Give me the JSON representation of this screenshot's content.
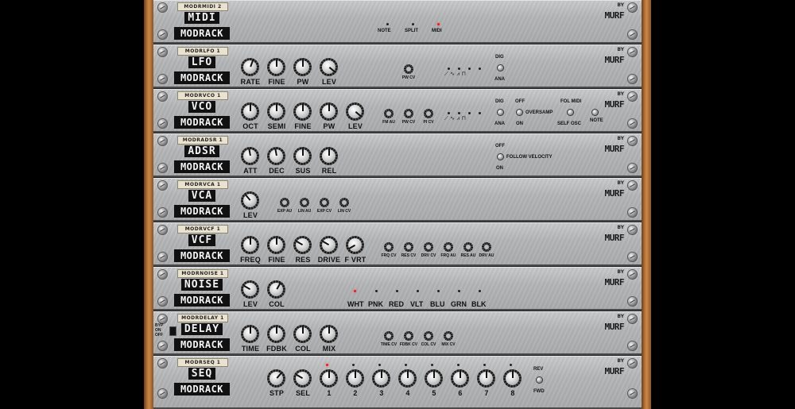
{
  "brand": {
    "byline": "BY",
    "logo": "MURF",
    "modrack": "MODRACK"
  },
  "modules": {
    "midi": {
      "tag": "MODRMIDI 2",
      "name": "MIDI",
      "modes": [
        "NOTE",
        "SPLIT",
        "MIDI"
      ],
      "active_mode": "MIDI"
    },
    "lfo": {
      "tag": "MODRLFO 1",
      "name": "LFO",
      "knobs": [
        "RATE",
        "FINE",
        "PW",
        "LEV"
      ],
      "cv": [
        "PW CV"
      ],
      "dig": "DIG",
      "ana": "ANA"
    },
    "vco": {
      "tag": "MODRVCO 1",
      "name": "VCO",
      "knobs": [
        "OCT",
        "SEMI",
        "FINE",
        "PW",
        "LEV"
      ],
      "cv": [
        "FM AU",
        "PW CV",
        "PI CV"
      ],
      "dig": "DIG",
      "ana": "ANA",
      "off": "OFF",
      "on": "ON",
      "oversamp": "OVERSAMP",
      "fol_midi": "FOL MIDI",
      "self_osc": "SELF OSC",
      "note": "NOTE"
    },
    "adsr": {
      "tag": "MODRADSR 1",
      "name": "ADSR",
      "knobs": [
        "ATT",
        "DEC",
        "SUS",
        "REL"
      ],
      "off": "OFF",
      "follow_velocity": "FOLLOW VELOCITY",
      "on": "ON"
    },
    "vca": {
      "tag": "MODRVCA 1",
      "name": "VCA",
      "knobs": [
        "LEV"
      ],
      "cv": [
        "EXP AU",
        "LIN AU",
        "EXP CV",
        "LIN CV"
      ]
    },
    "vcf": {
      "tag": "MODRVCF 1",
      "name": "VCF",
      "knobs": [
        "FREQ",
        "FINE",
        "RES",
        "DRIVE",
        "F VRT"
      ],
      "cv": [
        "FRQ CV",
        "RES CV",
        "DRV CV",
        "FRQ AU",
        "RES AU",
        "DRV AU"
      ]
    },
    "noise": {
      "tag": "MODRNOISE 1",
      "name": "NOISE",
      "knobs": [
        "LEV",
        "COL"
      ],
      "colors": [
        "WHT",
        "PNK",
        "RED",
        "VLT",
        "BLU",
        "GRN",
        "BLK"
      ],
      "active_color": "WHT"
    },
    "delay": {
      "tag": "MODRDELAY 1",
      "name": "DELAY",
      "knobs": [
        "TIME",
        "FDBK",
        "COL",
        "MIX"
      ],
      "cv": [
        "TIME CV",
        "FDBK CV",
        "COL CV",
        "MIX CV"
      ],
      "bypass": "BYP\nON\nOFF"
    },
    "seq": {
      "tag": "MODRSEQ 1",
      "name": "SEQ",
      "knobs": [
        "STP",
        "SEL",
        "1",
        "2",
        "3",
        "4",
        "5",
        "6",
        "7",
        "8"
      ],
      "rev": "REV",
      "fwd": "FWD",
      "active_step": "1"
    }
  }
}
